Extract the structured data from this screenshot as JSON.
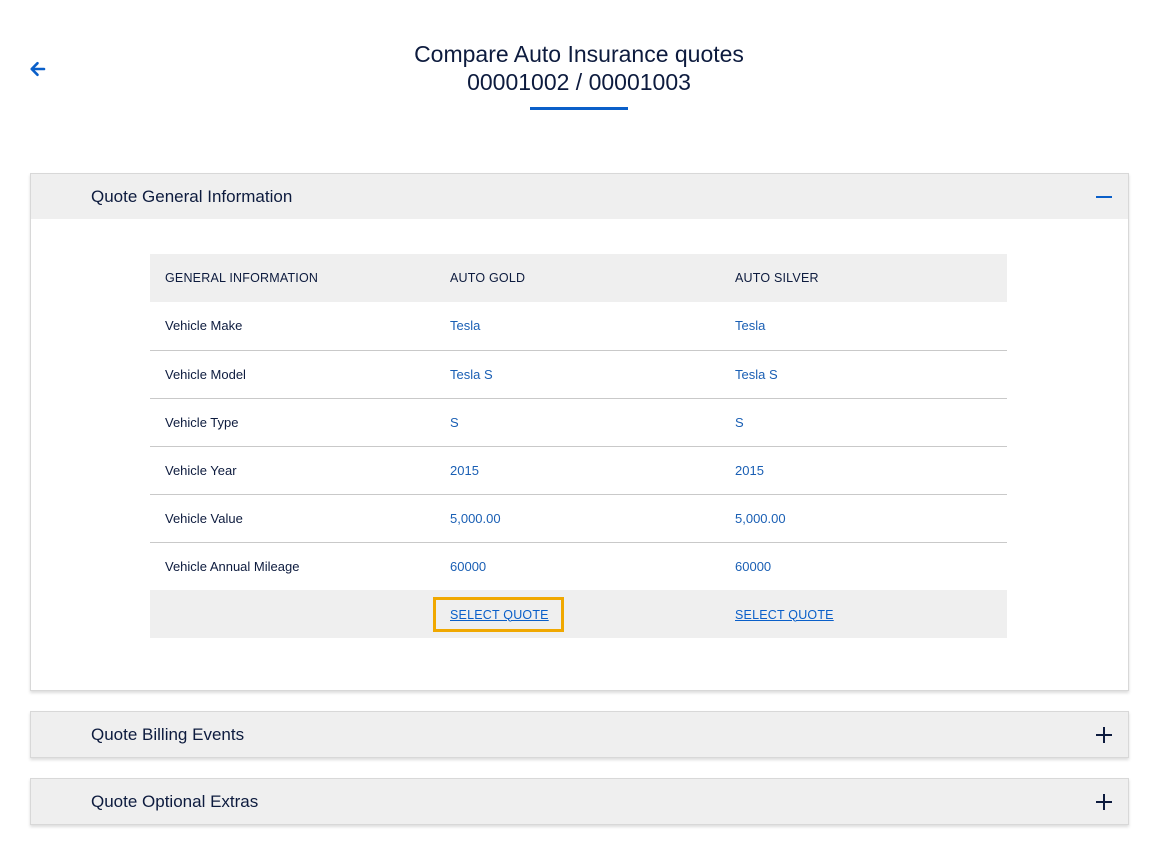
{
  "header": {
    "title": "Compare Auto Insurance quotes",
    "subtitle": "00001002 / 00001003",
    "accent_color": "#0a5fc9"
  },
  "nav": {
    "back_icon": "arrow-left-icon"
  },
  "panels": [
    {
      "title": "Quote General Information",
      "expanded": true,
      "toggle_icon": "minus-icon"
    },
    {
      "title": "Quote Billing Events",
      "expanded": false,
      "toggle_icon": "plus-icon"
    },
    {
      "title": "Quote Optional Extras",
      "expanded": false,
      "toggle_icon": "plus-icon"
    }
  ],
  "table": {
    "headers": [
      "GENERAL INFORMATION",
      "AUTO GOLD",
      "AUTO SILVER"
    ],
    "rows": [
      {
        "label": "Vehicle Make",
        "gold": "Tesla",
        "silver": "Tesla"
      },
      {
        "label": "Vehicle Model",
        "gold": "Tesla S",
        "silver": "Tesla S"
      },
      {
        "label": "Vehicle Type",
        "gold": "S",
        "silver": "S"
      },
      {
        "label": "Vehicle Year",
        "gold": "2015",
        "silver": "2015"
      },
      {
        "label": "Vehicle Value",
        "gold": "5,000.00",
        "silver": "5,000.00"
      },
      {
        "label": "Vehicle Annual Mileage",
        "gold": "60000",
        "silver": "60000"
      }
    ],
    "actions": {
      "gold": "SELECT QUOTE",
      "silver": "SELECT QUOTE"
    }
  }
}
